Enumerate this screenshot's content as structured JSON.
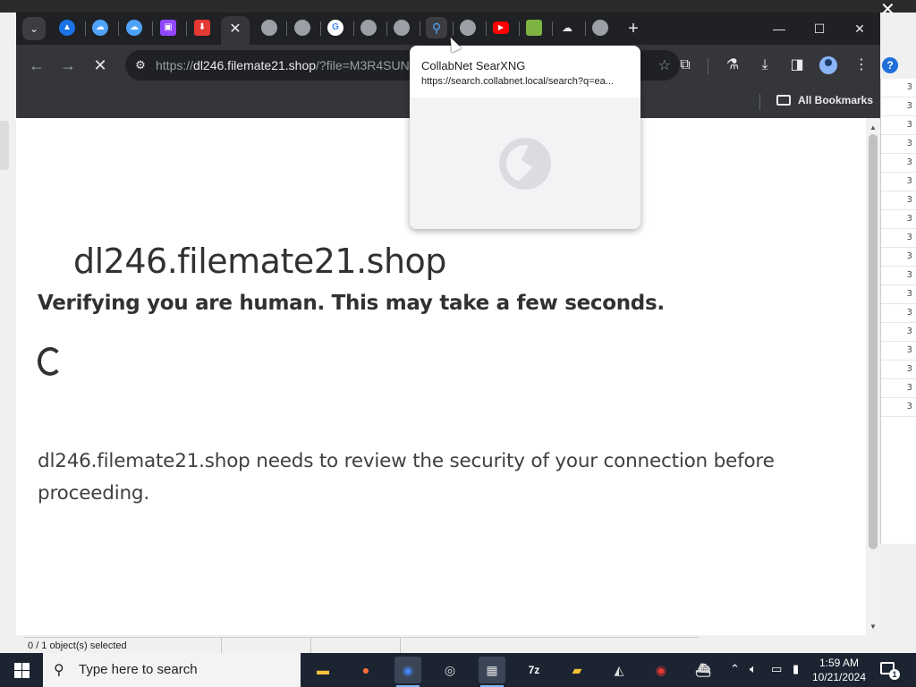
{
  "background_window": {
    "status_text": "0 / 1 object(s) selected",
    "right_column_rows": [
      "3",
      "3",
      "3",
      "3",
      "3",
      "3",
      "3",
      "3",
      "3",
      "3",
      "3",
      "3",
      "3",
      "3",
      "3",
      "3",
      "3",
      "3"
    ]
  },
  "browser": {
    "tabs": [
      {
        "icon": "chevron-down-icon"
      },
      {
        "icon": "triangle-app-icon",
        "color": "#1a73e8"
      },
      {
        "icon": "cloud-icon",
        "color": "#4ea3f8"
      },
      {
        "icon": "cloud-icon",
        "color": "#4ea3f8"
      },
      {
        "icon": "twitch-icon",
        "color": "#9146ff"
      },
      {
        "icon": "download-icon",
        "color": "#e53935"
      },
      {
        "icon": "close-icon",
        "active": true
      },
      {
        "icon": "globe-icon"
      },
      {
        "icon": "globe-icon"
      },
      {
        "icon": "google-icon"
      },
      {
        "icon": "globe-icon"
      },
      {
        "icon": "globe-icon"
      },
      {
        "icon": "search-icon",
        "color": "#1a73e8"
      },
      {
        "icon": "globe-icon"
      },
      {
        "icon": "youtube-icon",
        "color": "#ff0000"
      },
      {
        "icon": "map-icon"
      },
      {
        "icon": "cloud-upload-icon"
      },
      {
        "icon": "globe-icon"
      }
    ],
    "address_url_prefix": "https://",
    "address_url_host": "dl246.filemate21.shop",
    "address_url_path": "/?file=M3R4SUN",
    "bookmarks_label": "All Bookmarks"
  },
  "hover_card": {
    "title": "CollabNet SearXNG",
    "url": "https://search.collabnet.local/search?q=ea..."
  },
  "page": {
    "site_title": "dl246.filemate21.shop",
    "verify_message": "Verifying you are human. This may take a few seconds.",
    "review_message": "dl246.filemate21.shop needs to review the security of your connection before proceeding."
  },
  "taskbar": {
    "search_placeholder": "Type here to search",
    "time": "1:59 AM",
    "date": "10/21/2024",
    "notification_count": "1",
    "apps": [
      {
        "name": "file-explorer-icon"
      },
      {
        "name": "firefox-icon"
      },
      {
        "name": "chrome-icon",
        "active": true
      },
      {
        "name": "obs-icon"
      },
      {
        "name": "video-editor-icon",
        "active": true
      },
      {
        "name": "7zip-icon",
        "label": "7z"
      },
      {
        "name": "paint-icon"
      },
      {
        "name": "inkscape-icon"
      },
      {
        "name": "record-icon"
      },
      {
        "name": "ship-icon"
      }
    ]
  }
}
